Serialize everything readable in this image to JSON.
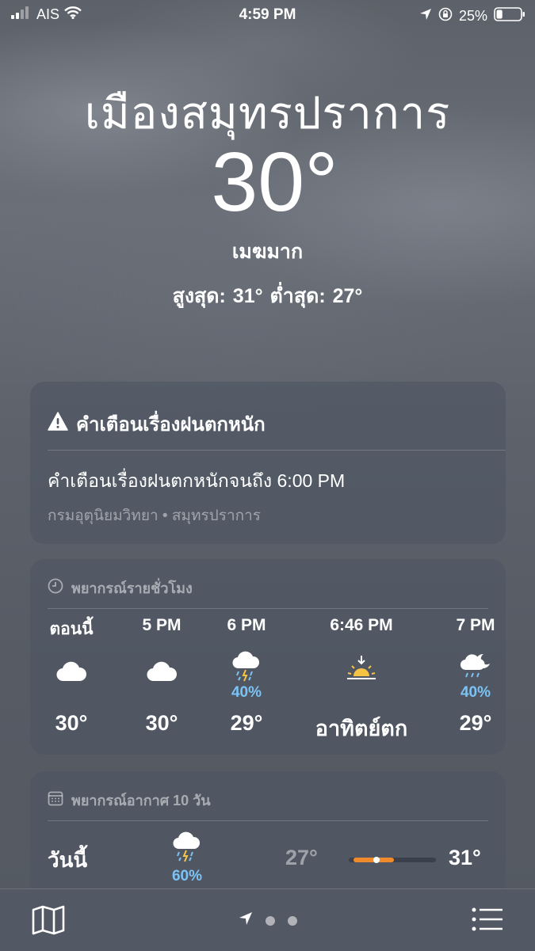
{
  "status_bar": {
    "carrier": "AIS",
    "time": "4:59 PM",
    "battery": "25%",
    "battery_level": 0.25
  },
  "location": {
    "city": "เมืองสมุทรปราการ",
    "temperature": "30°",
    "condition": "เมฆมาก",
    "high_low": "สูงสุด: 31°  ต่ำสุด: 27°"
  },
  "alert": {
    "title": "คำเตือนเรื่องฝนตกหนัก",
    "text": "คำเตือนเรื่องฝนตกหนักจนถึง 6:00 PM",
    "source": "กรมอุตุนิยมวิทยา • สมุทรปราการ",
    "icon": "warning-triangle-icon"
  },
  "hourly": {
    "header": "พยากรณ์รายชั่วโมง",
    "header_icon": "clock-icon",
    "items": [
      {
        "time": "ตอนนี้",
        "icon": "cloud-icon",
        "pct": "",
        "temp": "30°"
      },
      {
        "time": "5 PM",
        "icon": "cloud-icon",
        "pct": "",
        "temp": "30°"
      },
      {
        "time": "6 PM",
        "icon": "thunderstorm-rain-icon",
        "pct": "40%",
        "temp": "29°"
      },
      {
        "time": "6:46 PM",
        "icon": "sunset-icon",
        "pct": "",
        "temp": "อาทิตย์ตก"
      },
      {
        "time": "7 PM",
        "icon": "night-rain-icon",
        "pct": "40%",
        "temp": "29°"
      }
    ]
  },
  "daily": {
    "header": "พยากรณ์อากาศ 10 วัน",
    "header_icon": "calendar-icon",
    "today": {
      "name": "วันนี้",
      "icon": "thunderstorm-rain-icon",
      "pct": "60%",
      "low": "27°",
      "high": "31°",
      "range_start": 0.05,
      "range_end": 0.52,
      "current_position": 0.32
    }
  },
  "colors": {
    "accent_rain": "#7cc3f5",
    "temp_bar": "#f08a2a",
    "sun": "#f6c445"
  },
  "toolbar": {
    "map_icon": "map-icon",
    "location_icon": "location-arrow-icon",
    "list_icon": "list-icon"
  }
}
